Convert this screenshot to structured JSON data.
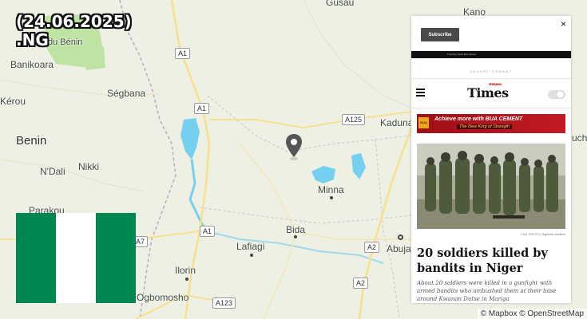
{
  "overlay": {
    "date": "(24.06.2025)",
    "country_code": ".NG",
    "flag_colors": [
      "#008751",
      "#ffffff",
      "#008751"
    ]
  },
  "map": {
    "labels": {
      "gusau": "Gusau",
      "kano": "Kano",
      "du_benin": "du Bénin",
      "banikoara": "Banikoara",
      "segbana": "Ségbana",
      "kerou": "Kérou",
      "benin": "Benin",
      "kaduna": "Kaduna",
      "uchi": "uchi",
      "ndali": "N'Dali",
      "nikki": "Nikki",
      "minna": "Minna",
      "parakou": "Parakou",
      "bida": "Bida",
      "abuja": "Abuja",
      "lafiagi": "Lafiagi",
      "ilorin": "Ilorin",
      "ogbomosho": "Ogbomosho"
    },
    "roads": {
      "a1_top": "A1",
      "a1_mid": "A1",
      "a1_bottom": "A1",
      "a125": "A125",
      "a7": "A7",
      "a2_upper": "A2",
      "a2_lower": "A2",
      "a123": "A123"
    },
    "colors": {
      "land": "#eef0e4",
      "park": "#bfe3a3",
      "water": "#75cfef",
      "road": "#f7e08e",
      "marker": "#555555"
    }
  },
  "article": {
    "close": "×",
    "subscribe": "Subscribe",
    "advertisement": "ADVERTISEMENT",
    "topbar_links": "Trending   News   Most Read",
    "logo": "Times",
    "logo_small": "PREMIUM",
    "banner_line1": "Achieve more with BUA CEMENT",
    "banner_line2": "The New King of Strength",
    "banner_logo": "BUA",
    "photo_caption": "FILE PHOTO: Nigerian soldiers",
    "headline": "20 soldiers killed by bandits in Niger",
    "excerpt": "About 20 soldiers were killed in a gunfight with armed bandits who ambushed them at their base around Kwanan Dutse in Mariga"
  },
  "attribution": "© Mapbox © OpenStreetMap"
}
